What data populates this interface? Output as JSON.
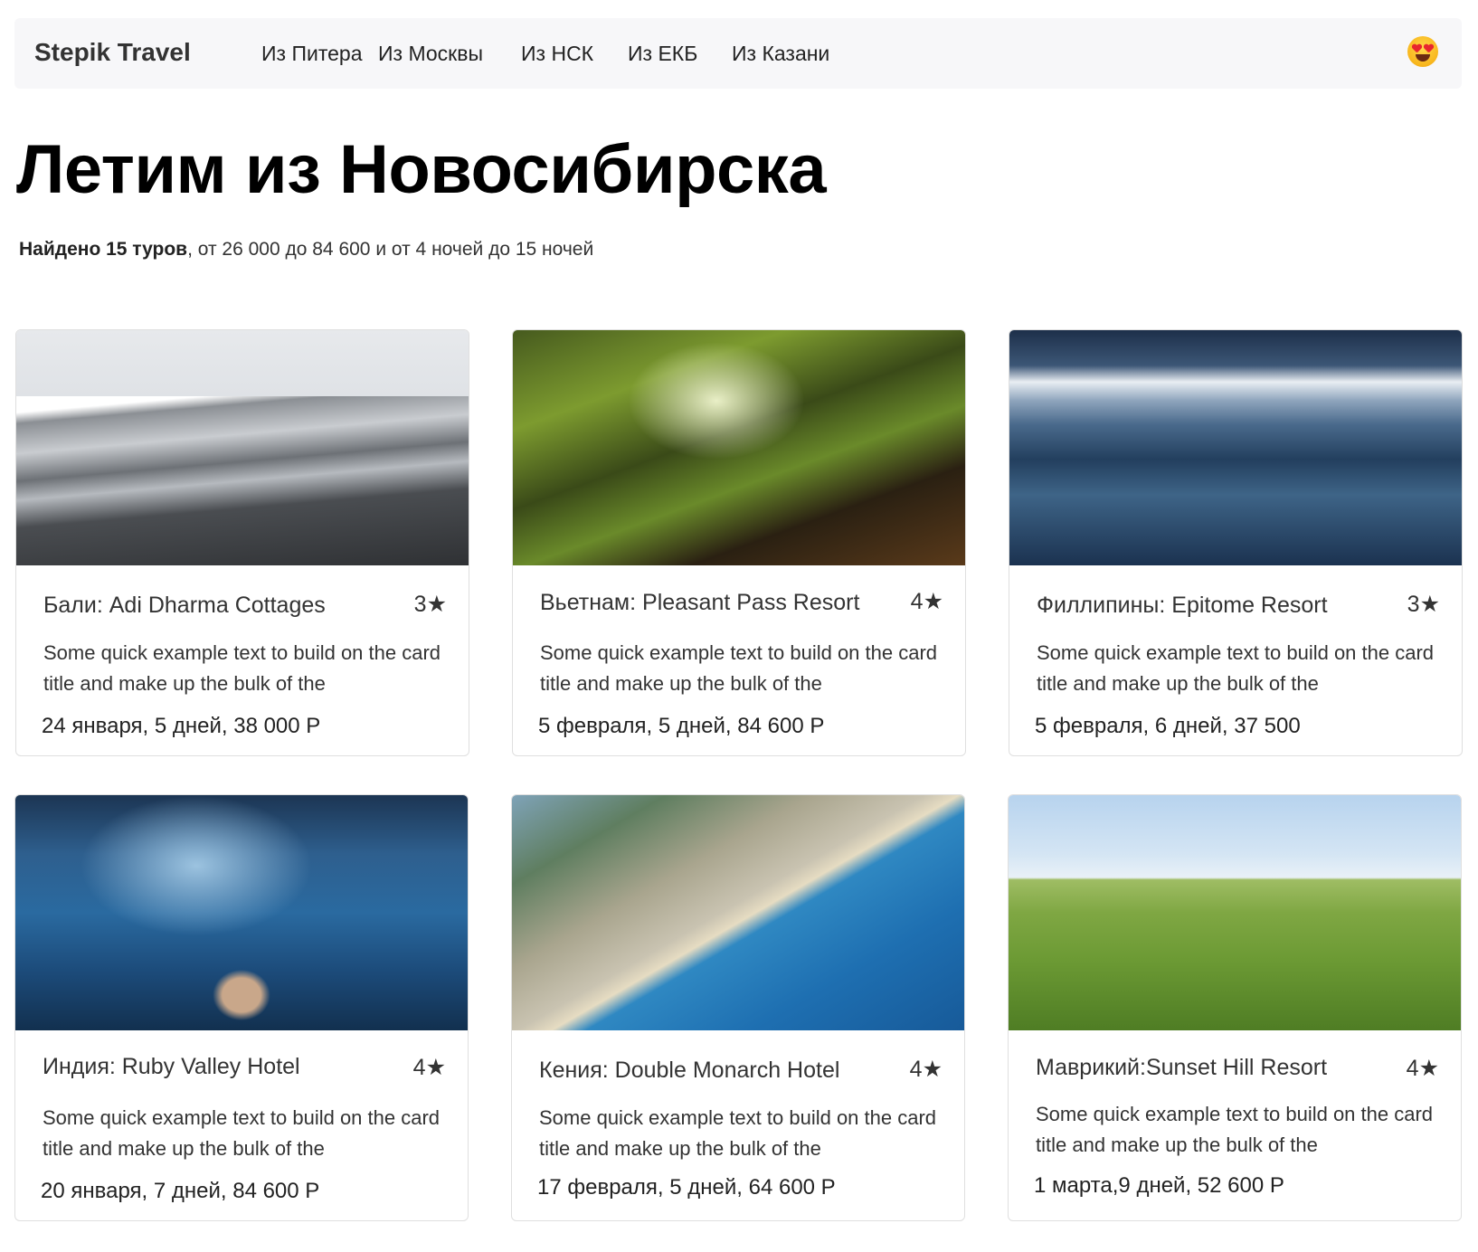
{
  "navbar": {
    "brand": "Stepik Travel",
    "links": [
      "Из Питера",
      "Из Москвы",
      "Из НСК",
      "Из ЕКБ",
      "Из Казани"
    ],
    "emoji_icon": "heart-eyes-emoji"
  },
  "header": {
    "title_prefix": "Летим из ",
    "title_city": "Новосибирска",
    "found_label": "Найдено 15 туров",
    "range_text": ", от 26 000 до 84 600 и от 4 ночей до 15 ночей"
  },
  "cards": [
    {
      "title": "Бали: Adi Dharma Cottages",
      "stars": "3★",
      "text": "Some quick example text to build on the card title and make up the bulk of the",
      "meta": "24 января, 5 дней, 38 000 Р"
    },
    {
      "title": "Вьетнам: Pleasant Pass Resort",
      "stars": "4★",
      "text": "Some quick example text to build on the card title and make up the bulk of the",
      "meta": "5 февраля, 5 дней, 84 600 Р"
    },
    {
      "title": "Филлипины: Epitome Resort",
      "stars": "3★",
      "text": "Some quick example text to build on the card title and make up the bulk of the",
      "meta": "5 февраля, 6 дней,  37 500"
    },
    {
      "title": "Индия: Ruby Valley Hotel",
      "stars": "4★",
      "text": "Some quick example text to build on the card title and make up the bulk of the",
      "meta": "20 января, 7 дней, 84 600 Р"
    },
    {
      "title": "Кения: Double Monarch Hotel",
      "stars": "4★",
      "text": "Some quick example text to build on the card title and make up the bulk of the",
      "meta": "17 февраля, 5 дней, 64 600 Р"
    },
    {
      "title": "Маврикий:Sunset Hill Resort",
      "stars": "4★",
      "text": "Some quick example text to build on the card title and make up the bulk of the",
      "meta": "1 марта,9  дней, 52 600 Р"
    }
  ]
}
